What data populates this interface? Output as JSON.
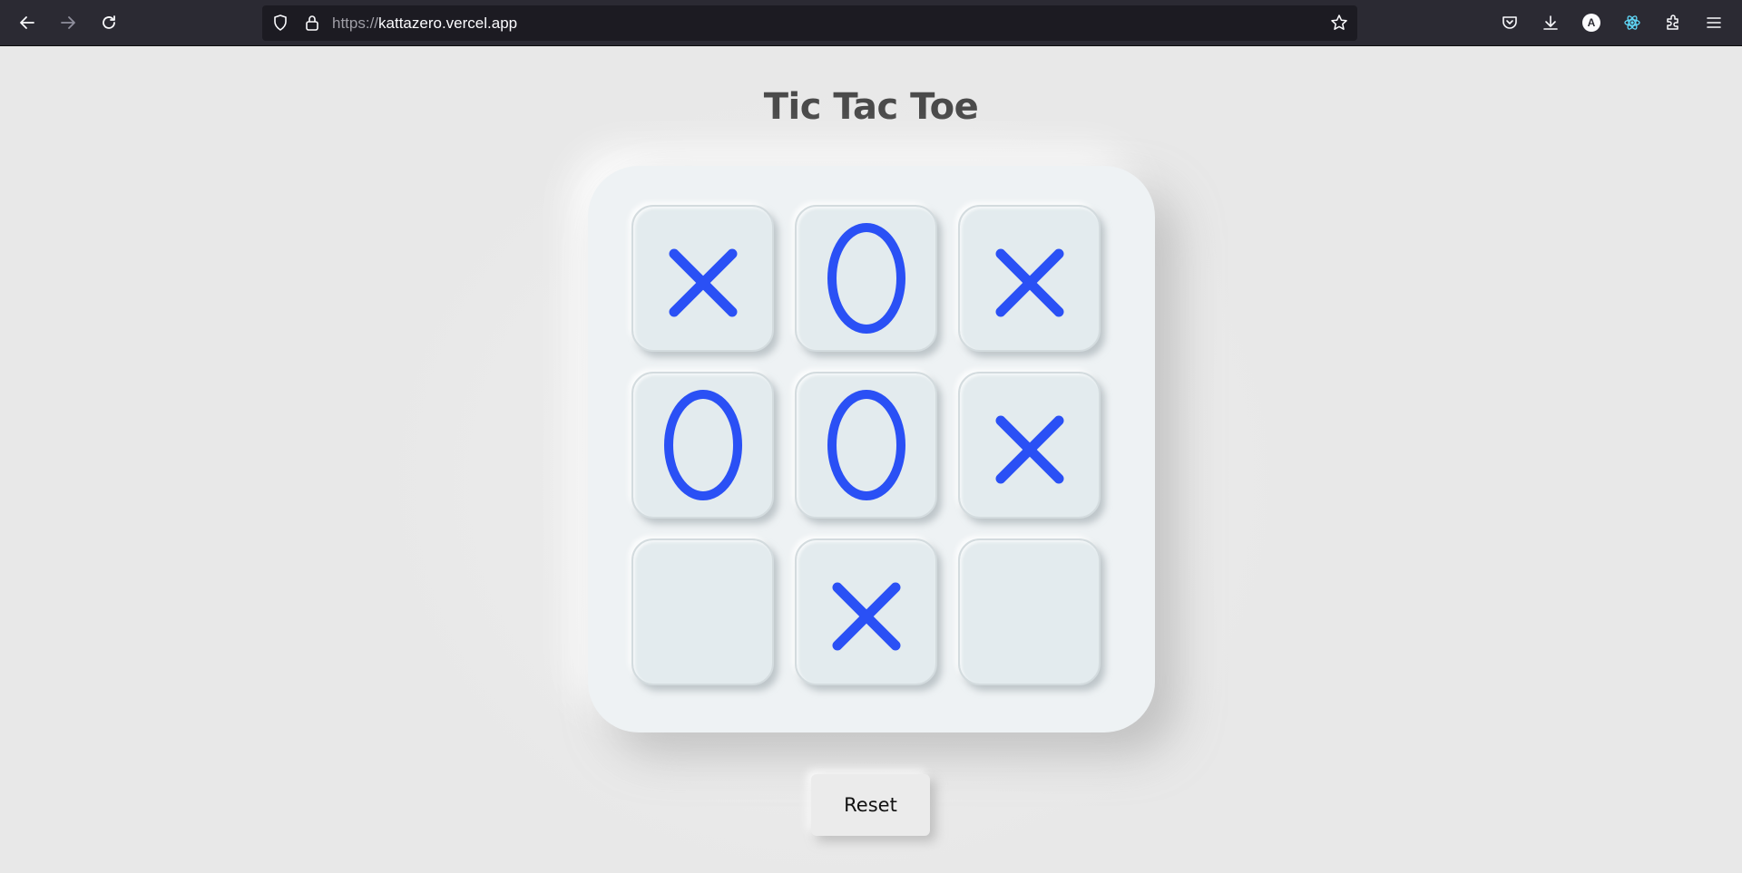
{
  "browser": {
    "url_scheme": "https://",
    "url_host": "kattazero.vercel.app",
    "icons": [
      "back-icon",
      "forward-icon",
      "reload-icon",
      "shield-icon",
      "lock-icon",
      "star-icon",
      "pocket-icon",
      "download-icon",
      "account-icon",
      "react-devtools-icon",
      "extensions-icon",
      "menu-icon"
    ],
    "account_initial": "A"
  },
  "game": {
    "title": "Tic Tac Toe",
    "board": [
      "X",
      "O",
      "X",
      "O",
      "O",
      "X",
      "",
      "X",
      ""
    ],
    "mark_color": "#2a50f5",
    "reset_label": "Reset"
  }
}
